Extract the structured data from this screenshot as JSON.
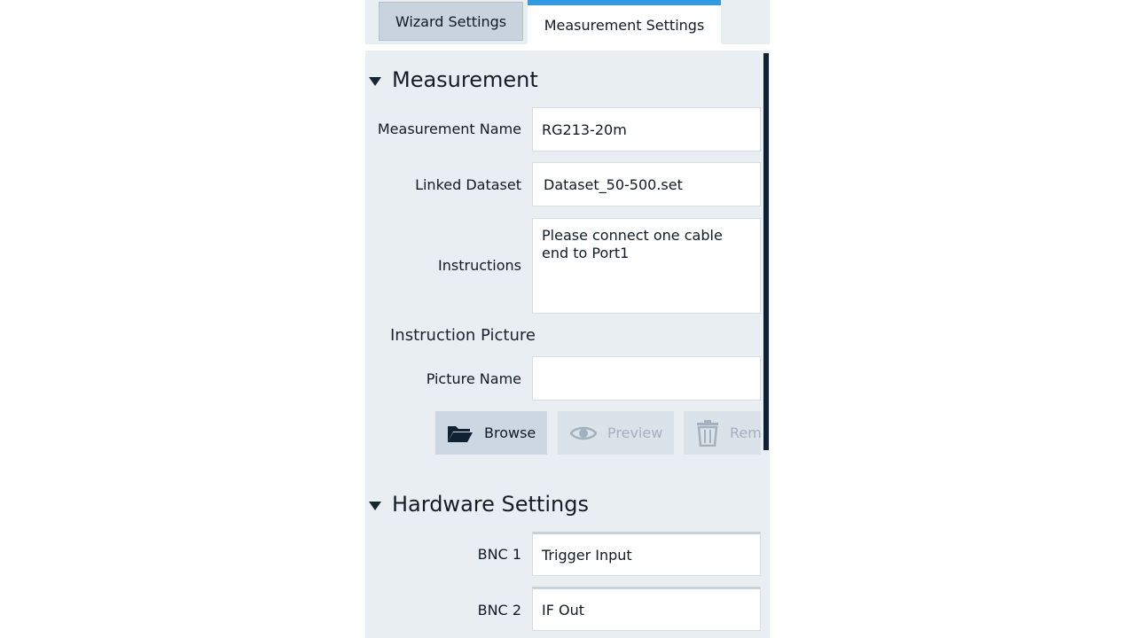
{
  "tabs": {
    "wizard_label": "Wizard Settings",
    "measurement_label": "Measurement Settings"
  },
  "measurement": {
    "header": "Measurement",
    "name_label": "Measurement Name",
    "name_value": "RG213-20m",
    "dataset_label": "Linked Dataset",
    "dataset_value": "Dataset_50-500.set",
    "instructions_label": "Instructions",
    "instructions_value": "Please connect one cable end to Port1",
    "picture_heading": "Instruction Picture",
    "picture_label": "Picture Name",
    "picture_value": "",
    "buttons": {
      "browse": "Browse",
      "preview": "Preview",
      "remove": "Rem"
    }
  },
  "hardware": {
    "header": "Hardware Settings",
    "bnc1_label": "BNC 1",
    "bnc1_value": "Trigger Input",
    "bnc2_label": "BNC 2",
    "bnc2_value": "IF Out"
  },
  "icons": {
    "section_toggle": "triangle-down-icon",
    "browse": "folder-open-icon",
    "preview": "eye-icon",
    "remove": "trash-icon"
  },
  "colors": {
    "accent": "#2f9be6",
    "panel_background": "#e9eef2",
    "disabled_text": "#a3b0bd"
  }
}
